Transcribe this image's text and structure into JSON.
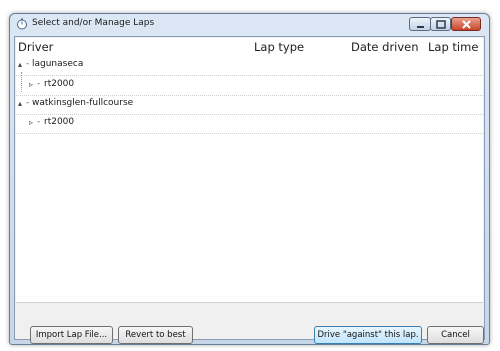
{
  "window": {
    "title": "Select and/or Manage Laps"
  },
  "columns": {
    "driver": "Driver",
    "lap_type": "Lap type",
    "date_driven": "Date driven",
    "lap_time": "Lap time"
  },
  "tree": [
    {
      "label": "lagunaseca",
      "children": [
        {
          "label": "rt2000"
        }
      ]
    },
    {
      "label": "watkinsglen-fullcourse",
      "children": [
        {
          "label": "rt2000"
        }
      ]
    }
  ],
  "buttons": {
    "import": "Import Lap File...",
    "revert": "Revert to best",
    "drive_against": "Drive \"against\" this lap.",
    "cancel": "Cancel"
  },
  "icons": {
    "expanded": "▴",
    "collapsed": "▹"
  }
}
